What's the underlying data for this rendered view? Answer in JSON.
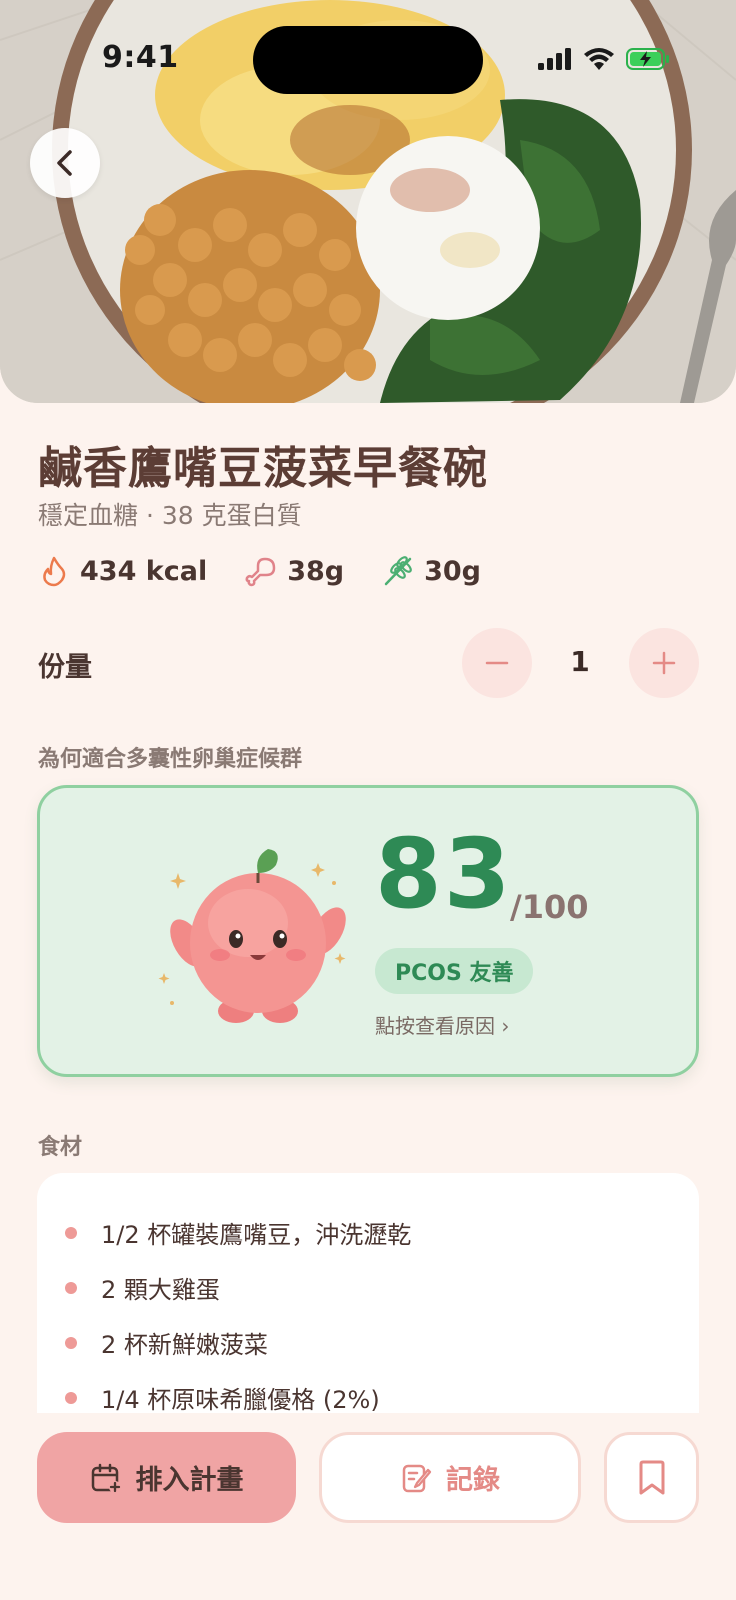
{
  "status_bar": {
    "time": "9:41"
  },
  "recipe": {
    "title": "鹹香鷹嘴豆菠菜早餐碗",
    "subtitle": "穩定血糖 · 38 克蛋白質",
    "macros": [
      {
        "icon": "flame-icon",
        "value": "434 kcal"
      },
      {
        "icon": "drumstick-icon",
        "value": "38g"
      },
      {
        "icon": "wheat-icon",
        "value": "30g"
      }
    ]
  },
  "servings": {
    "label": "份量",
    "value": "1"
  },
  "pcos": {
    "section_label": "為何適合多囊性卵巢症候群",
    "score": "83",
    "max": "/100",
    "badge": "PCOS 友善",
    "tap_reason": "點按查看原因 ›"
  },
  "ingredients": {
    "section_label": "食材",
    "items": [
      "1/2 杯罐裝鷹嘴豆，沖洗瀝乾",
      "2 顆大雞蛋",
      "2 杯新鮮嫩菠菜",
      "1/4 杯原味希臘優格 (2%)"
    ]
  },
  "actions": {
    "plan_label": "排入計畫",
    "log_label": "記錄"
  },
  "colors": {
    "background": "#fdf3ee",
    "accent_pink": "#f0a4a4",
    "score_green": "#2e8a55",
    "card_green": "#e3f2e6"
  }
}
